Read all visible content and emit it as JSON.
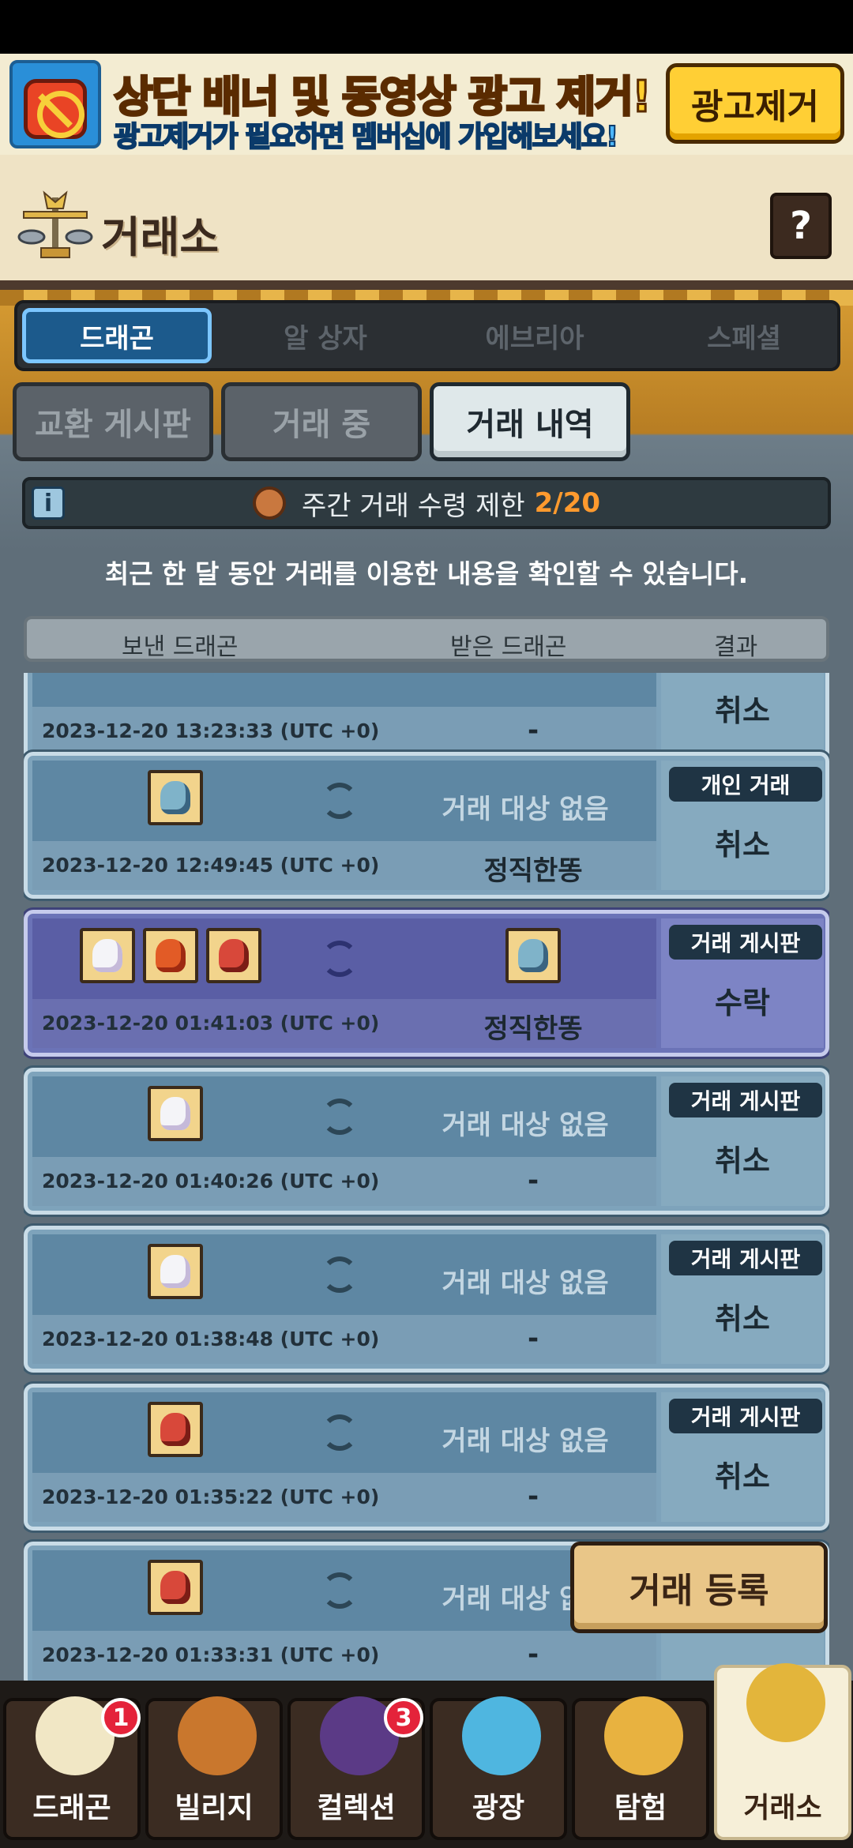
{
  "ad": {
    "title": "상단 배너 및 동영상 광고 제거!",
    "subtitle": "광고제거가 필요하면 멤버십에 가입해보세요!",
    "button": "광고제거"
  },
  "header": {
    "title": "거래소",
    "help": "?"
  },
  "category_tabs": [
    {
      "label": "드래곤",
      "active": true
    },
    {
      "label": "알 상자",
      "active": false
    },
    {
      "label": "에브리아",
      "active": false
    },
    {
      "label": "스페셜",
      "active": false
    }
  ],
  "sub_tabs": [
    {
      "label": "교환 게시판",
      "active": false
    },
    {
      "label": "거래 중",
      "active": false
    },
    {
      "label": "거래 내역",
      "active": true
    }
  ],
  "info": {
    "icon": "i",
    "text": "주간 거래 수령 제한",
    "quota": "2/20"
  },
  "notice": "최근 한 달 동안 거래를 이용한 내용을 확인할 수 있습니다.",
  "columns": {
    "sent": "보낸 드래곤",
    "received": "받은 드래곤",
    "result": "결과"
  },
  "records": [
    {
      "timestamp": "2023-12-20 13:23:33 (UTC +0)",
      "counterpart": "",
      "receiver": "-",
      "type": "",
      "result": "취소",
      "accepted": false,
      "sent_icons": [],
      "recv_icons": []
    },
    {
      "timestamp": "2023-12-20 12:49:45 (UTC +0)",
      "counterpart": "거래 대상 없음",
      "receiver": "정직한똥",
      "type": "개인 거래",
      "result": "취소",
      "accepted": false,
      "sent_icons": [
        "blue"
      ],
      "recv_icons": []
    },
    {
      "timestamp": "2023-12-20 01:41:03 (UTC +0)",
      "counterpart": "",
      "receiver": "정직한똥",
      "type": "거래 게시판",
      "result": "수락",
      "accepted": true,
      "sent_icons": [
        "white",
        "flame",
        "red"
      ],
      "recv_icons": [
        "blue"
      ]
    },
    {
      "timestamp": "2023-12-20 01:40:26 (UTC +0)",
      "counterpart": "거래 대상 없음",
      "receiver": "-",
      "type": "거래 게시판",
      "result": "취소",
      "accepted": false,
      "sent_icons": [
        "white"
      ],
      "recv_icons": []
    },
    {
      "timestamp": "2023-12-20 01:38:48 (UTC +0)",
      "counterpart": "거래 대상 없음",
      "receiver": "-",
      "type": "거래 게시판",
      "result": "취소",
      "accepted": false,
      "sent_icons": [
        "white"
      ],
      "recv_icons": []
    },
    {
      "timestamp": "2023-12-20 01:35:22 (UTC +0)",
      "counterpart": "거래 대상 없음",
      "receiver": "-",
      "type": "거래 게시판",
      "result": "취소",
      "accepted": false,
      "sent_icons": [
        "red"
      ],
      "recv_icons": []
    },
    {
      "timestamp": "2023-12-20 01:33:31 (UTC +0)",
      "counterpart": "거래 대상 없음",
      "receiver": "-",
      "type": "",
      "result": "",
      "accepted": false,
      "sent_icons": [
        "red"
      ],
      "recv_icons": []
    }
  ],
  "register_button": "거래 등록",
  "nav": [
    {
      "label": "드래곤",
      "badge": "1",
      "icon": "dragon-icon",
      "active": false
    },
    {
      "label": "빌리지",
      "badge": "",
      "icon": "house-icon",
      "active": false
    },
    {
      "label": "컬렉션",
      "badge": "3",
      "icon": "book-icon",
      "active": false
    },
    {
      "label": "광장",
      "badge": "",
      "icon": "fountain-icon",
      "active": false
    },
    {
      "label": "탐험",
      "badge": "",
      "icon": "compass-icon",
      "active": false
    },
    {
      "label": "거래소",
      "badge": "",
      "icon": "scale-icon",
      "active": true
    }
  ],
  "colors": {
    "accent_quota": "#ff9a2e",
    "accepted_row": "#6b73b7",
    "normal_row": "#7ea3bb",
    "badge": "#e4233a"
  }
}
